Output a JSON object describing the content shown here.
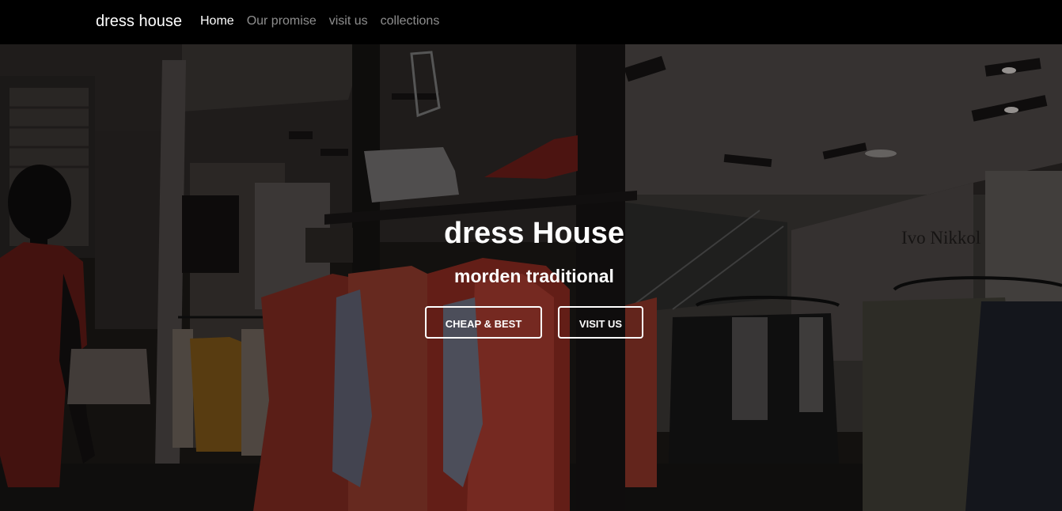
{
  "navbar": {
    "brand": "dress house",
    "links": [
      {
        "label": "Home",
        "active": true
      },
      {
        "label": "Our promise",
        "active": false
      },
      {
        "label": "visit us",
        "active": false
      },
      {
        "label": "collections",
        "active": false
      }
    ]
  },
  "hero": {
    "title": "dress House",
    "subtitle": "morden traditional",
    "buttons": {
      "cheap_label": "CHEAP & BEST",
      "visit_label": "VISIT US"
    },
    "background_sign": "Ivo Nikkol"
  },
  "colors": {
    "navbar_bg": "#000000",
    "text": "#ffffff",
    "nav_inactive": "rgba(255,255,255,0.55)"
  }
}
